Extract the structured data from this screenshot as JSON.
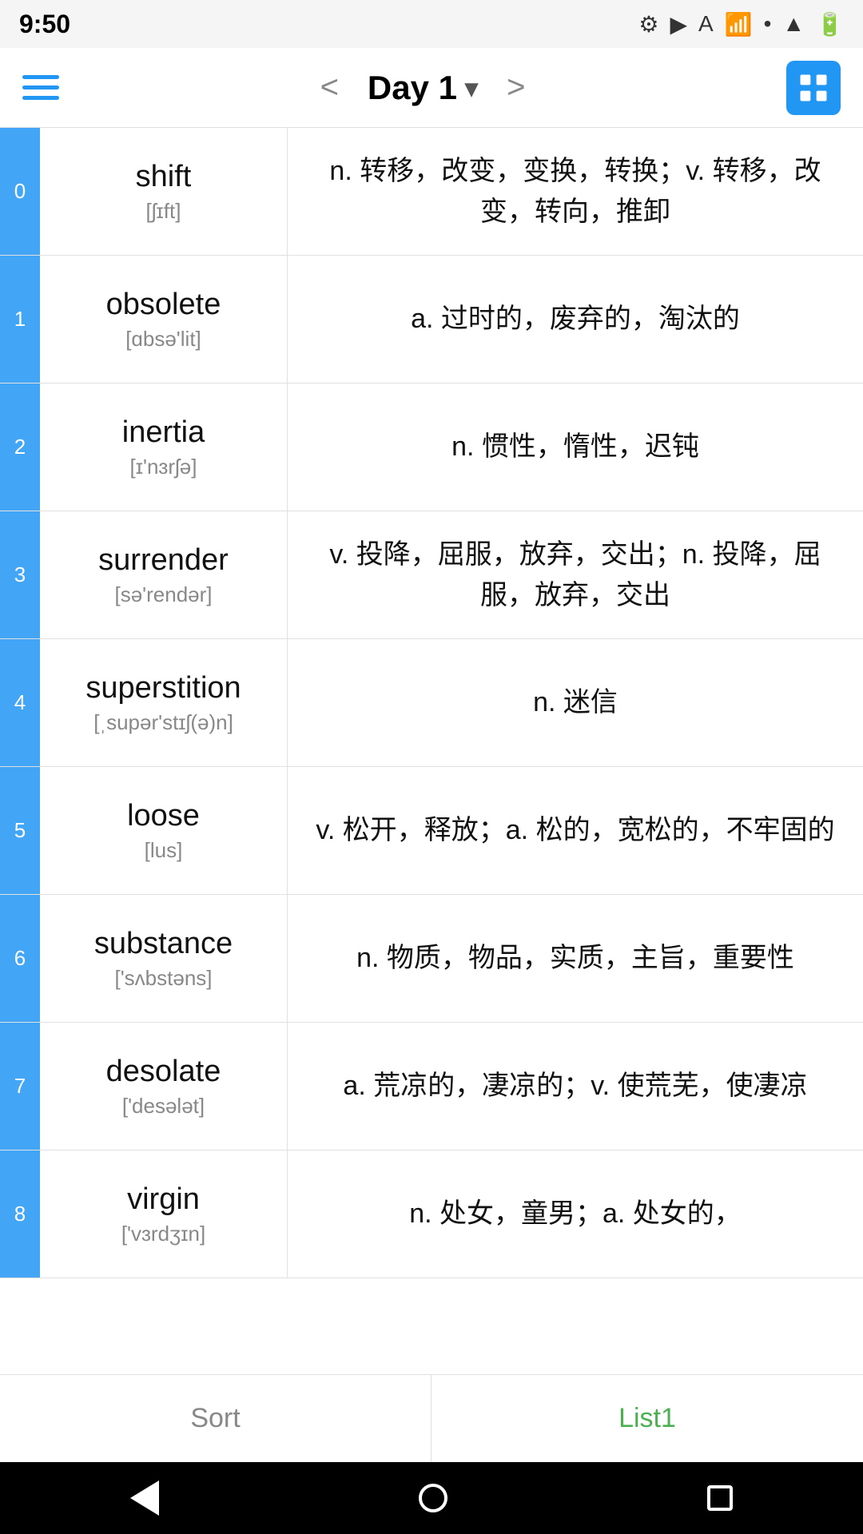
{
  "status_bar": {
    "time": "9:50",
    "icons": [
      "gear",
      "play-circle",
      "font",
      "wifi",
      "dot",
      "signal",
      "battery"
    ]
  },
  "header": {
    "menu_label": "menu",
    "prev_label": "<",
    "title": "Day 1",
    "dropdown_icon": "▾",
    "next_label": ">",
    "grid_label": "grid"
  },
  "words": [
    {
      "index": "0",
      "english": "shift",
      "phonetic": "[ʃɪft]",
      "definition": "n. 转移，改变，变换，转换；v. 转移，改变，转向，推卸"
    },
    {
      "index": "1",
      "english": "obsolete",
      "phonetic": "[ɑbsə'lit]",
      "definition": "a. 过时的，废弃的，淘汰的"
    },
    {
      "index": "2",
      "english": "inertia",
      "phonetic": "[ɪ'nɜrʃə]",
      "definition": "n. 惯性，惰性，迟钝"
    },
    {
      "index": "3",
      "english": "surrender",
      "phonetic": "[sə'rendər]",
      "definition": "v. 投降，屈服，放弃，交出；n. 投降，屈服，放弃，交出"
    },
    {
      "index": "4",
      "english": "superstition",
      "phonetic": "[ˌsupər'stɪʃ(ə)n]",
      "definition": "n. 迷信"
    },
    {
      "index": "5",
      "english": "loose",
      "phonetic": "[lus]",
      "definition": "v. 松开，释放；a. 松的，宽松的，不牢固的"
    },
    {
      "index": "6",
      "english": "substance",
      "phonetic": "['sʌbstəns]",
      "definition": "n. 物质，物品，实质，主旨，重要性"
    },
    {
      "index": "7",
      "english": "desolate",
      "phonetic": "['desələt]",
      "definition": "a. 荒凉的，凄凉的；v. 使荒芜，使凄凉"
    },
    {
      "index": "8",
      "english": "virgin",
      "phonetic": "['vɜrdʒɪn]",
      "definition": "n. 处女，童男；a. 处女的，"
    }
  ],
  "bottom_tabs": {
    "sort_label": "Sort",
    "list1_label": "List1"
  },
  "android_nav": {
    "back_label": "back",
    "home_label": "home",
    "recent_label": "recent"
  }
}
